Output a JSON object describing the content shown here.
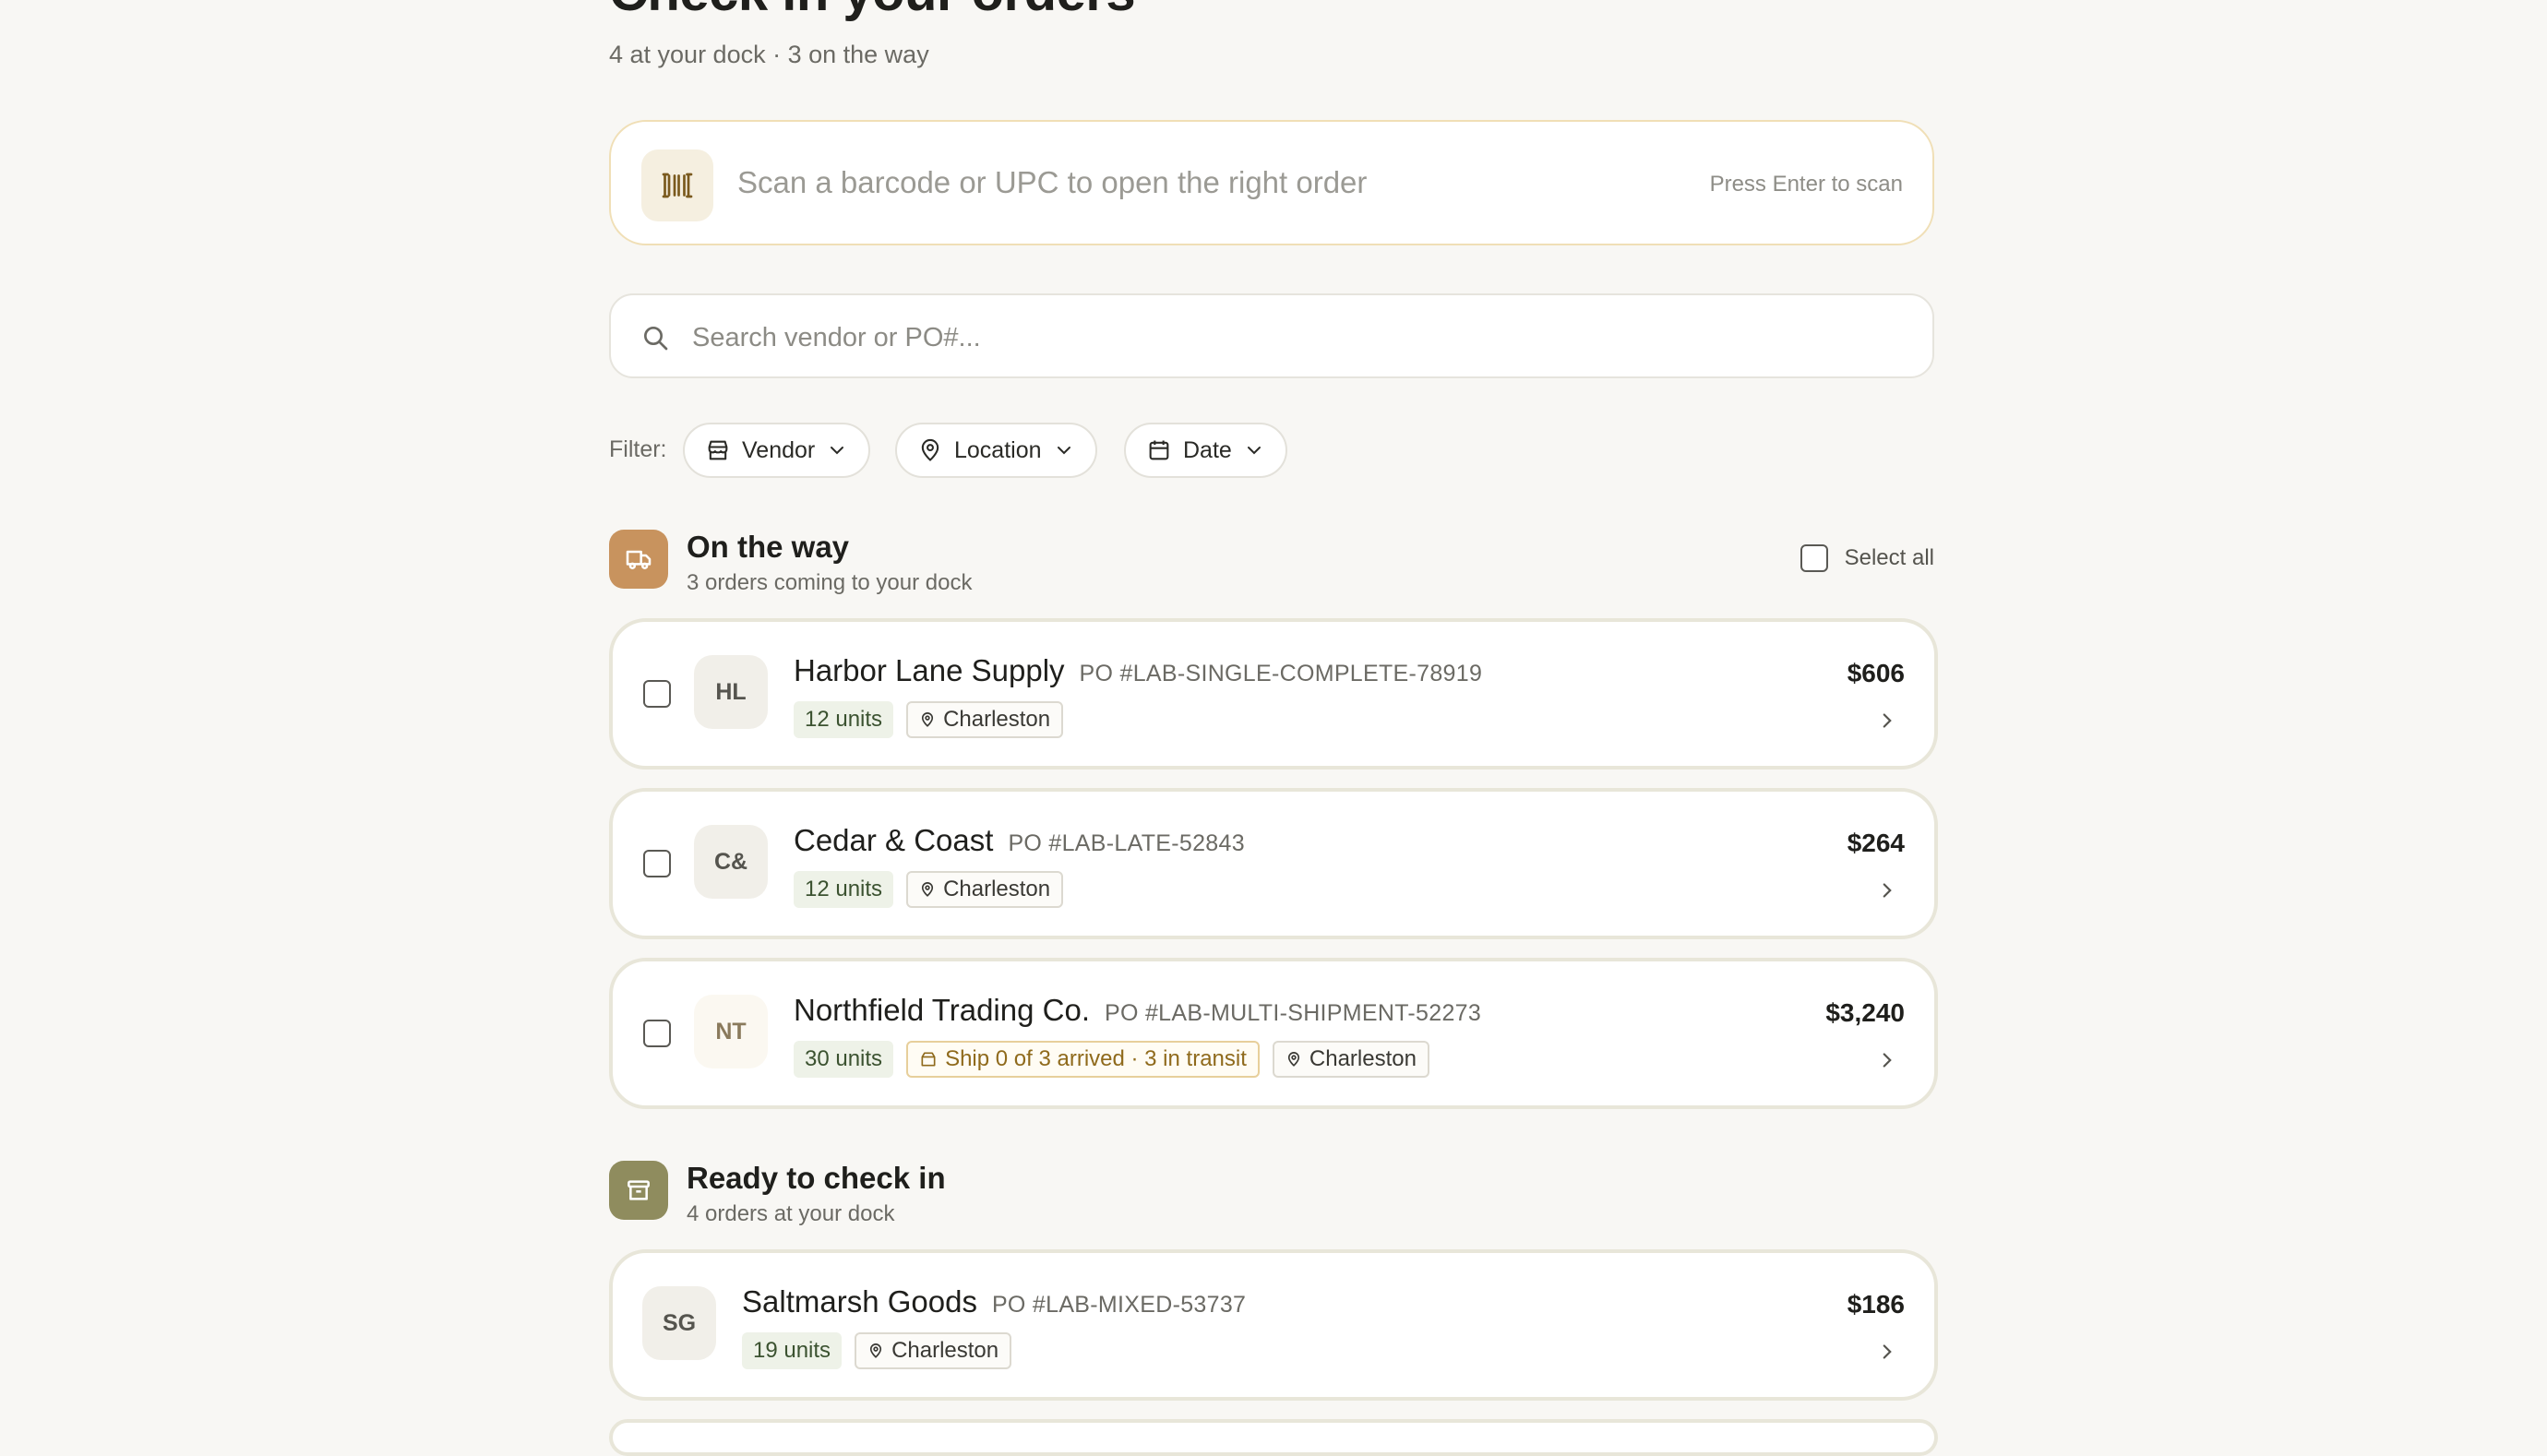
{
  "page": {
    "title": "Check in your orders",
    "subtitle": "4 at your dock · 3 on the way"
  },
  "scan": {
    "placeholder": "Scan a barcode or UPC to open the right order",
    "hint": "Press Enter to scan",
    "icon": "barcode-icon"
  },
  "search": {
    "placeholder": "Search vendor or PO#...",
    "value": "",
    "icon": "search-icon"
  },
  "filters": {
    "label": "Filter:",
    "vendor": "Vendor",
    "location": "Location",
    "date": "Date"
  },
  "on_the_way": {
    "title": "On the way",
    "subtitle": "3 orders coming to your dock",
    "select_all": "Select all",
    "accent": "#c8935e",
    "orders": [
      {
        "initials": "HL",
        "vendor": "Harbor Lane Supply",
        "po": "PO #LAB-SINGLE-COMPLETE-78919",
        "units": "12 units",
        "location": "Charleston",
        "amount": "$606"
      },
      {
        "initials": "C&",
        "vendor": "Cedar & Coast",
        "po": "PO #LAB-LATE-52843",
        "units": "12 units",
        "location": "Charleston",
        "amount": "$264"
      },
      {
        "initials": "NT",
        "vendor": "Northfield Trading Co.",
        "po": "PO #LAB-MULTI-SHIPMENT-52273",
        "units": "30 units",
        "shipment": "Ship 0 of 3 arrived · 3 in transit",
        "location": "Charleston",
        "amount": "$3,240"
      }
    ]
  },
  "ready": {
    "title": "Ready to check in",
    "subtitle": "4 orders at your dock",
    "accent": "#8f8c5e",
    "orders": [
      {
        "initials": "SG",
        "vendor": "Saltmarsh Goods",
        "po": "PO #LAB-MIXED-53737",
        "units": "19 units",
        "location": "Charleston",
        "amount": "$186"
      }
    ]
  }
}
